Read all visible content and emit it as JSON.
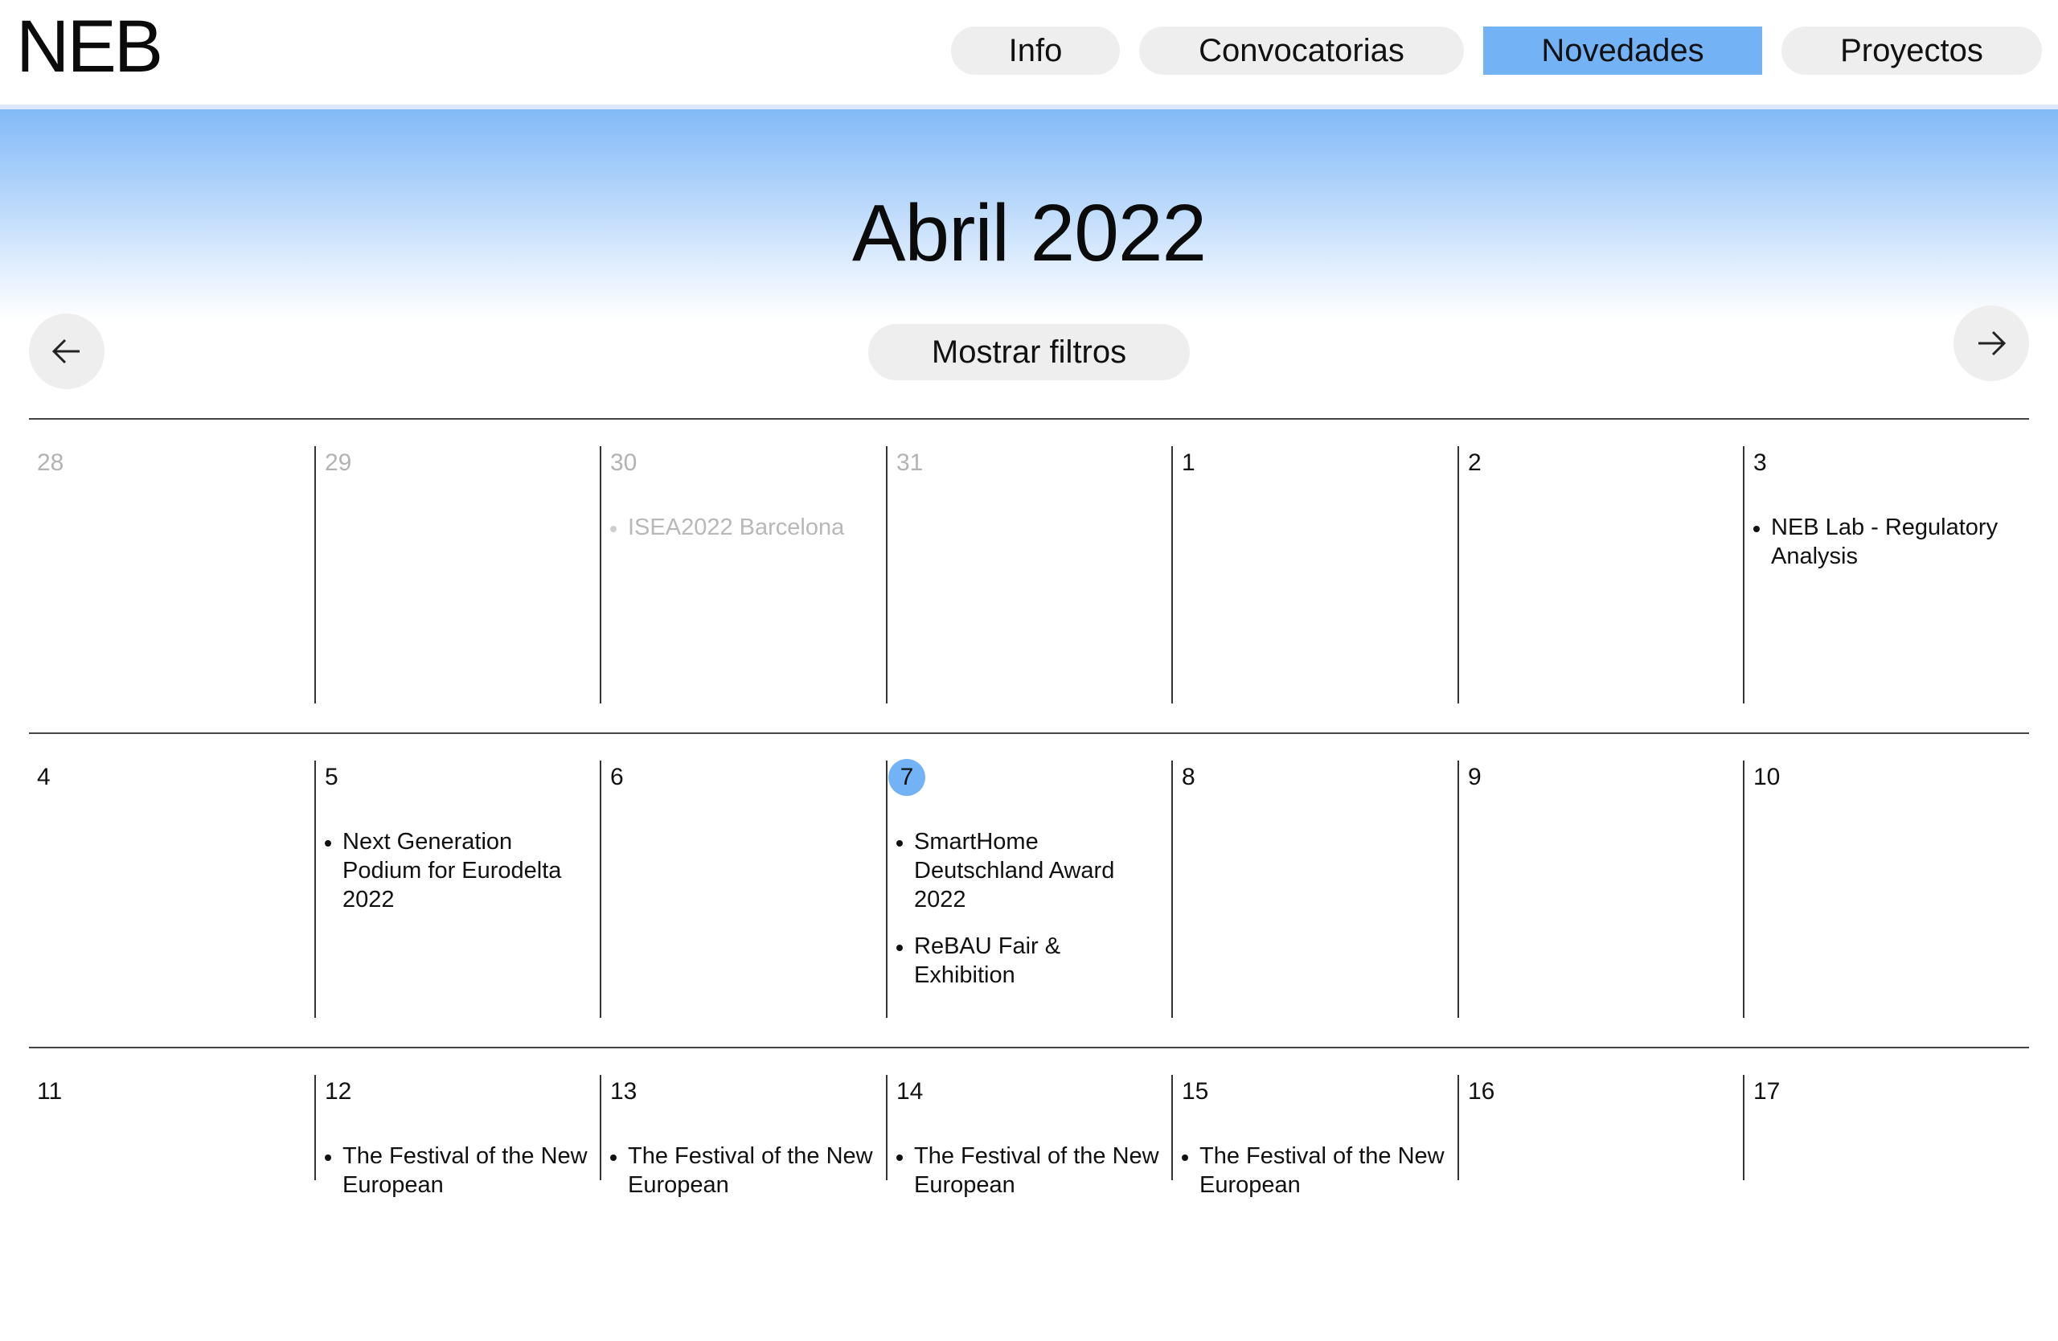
{
  "logo": "NEB",
  "nav": [
    {
      "label": "Info",
      "active": false
    },
    {
      "label": "Convocatorias",
      "active": false
    },
    {
      "label": "Novedades",
      "active": true
    },
    {
      "label": "Proyectos",
      "active": false
    }
  ],
  "calendar": {
    "month_title": "Abril 2022",
    "filters_label": "Mostrar filtros",
    "prev_icon": "arrow-left-icon",
    "next_icon": "arrow-right-icon",
    "today_color": "#73b3f5",
    "weeks": [
      [
        {
          "day": "28",
          "muted": true,
          "events": []
        },
        {
          "day": "29",
          "muted": true,
          "events": []
        },
        {
          "day": "30",
          "muted": true,
          "events": [
            {
              "title": "ISEA2022 Barcelona",
              "muted": true
            }
          ]
        },
        {
          "day": "31",
          "muted": true,
          "events": []
        },
        {
          "day": "1",
          "events": []
        },
        {
          "day": "2",
          "events": []
        },
        {
          "day": "3",
          "events": [
            {
              "title": "NEB Lab - Regulatory Analysis"
            }
          ]
        }
      ],
      [
        {
          "day": "4",
          "events": []
        },
        {
          "day": "5",
          "events": [
            {
              "title": "Next Generation Podium for Eurodelta 2022"
            }
          ]
        },
        {
          "day": "6",
          "events": []
        },
        {
          "day": "7",
          "today": true,
          "events": [
            {
              "title": "SmartHome Deutschland Award 2022"
            },
            {
              "title": "ReBAU Fair & Exhibition"
            }
          ]
        },
        {
          "day": "8",
          "events": []
        },
        {
          "day": "9",
          "events": []
        },
        {
          "day": "10",
          "events": []
        }
      ],
      [
        {
          "day": "11",
          "events": []
        },
        {
          "day": "12",
          "events": [
            {
              "title": "The Festival of the New European"
            }
          ]
        },
        {
          "day": "13",
          "events": [
            {
              "title": "The Festival of the New European"
            }
          ]
        },
        {
          "day": "14",
          "events": [
            {
              "title": "The Festival of the New European"
            }
          ]
        },
        {
          "day": "15",
          "events": [
            {
              "title": "The Festival of the New European"
            }
          ]
        },
        {
          "day": "16",
          "events": []
        },
        {
          "day": "17",
          "events": []
        }
      ]
    ]
  }
}
